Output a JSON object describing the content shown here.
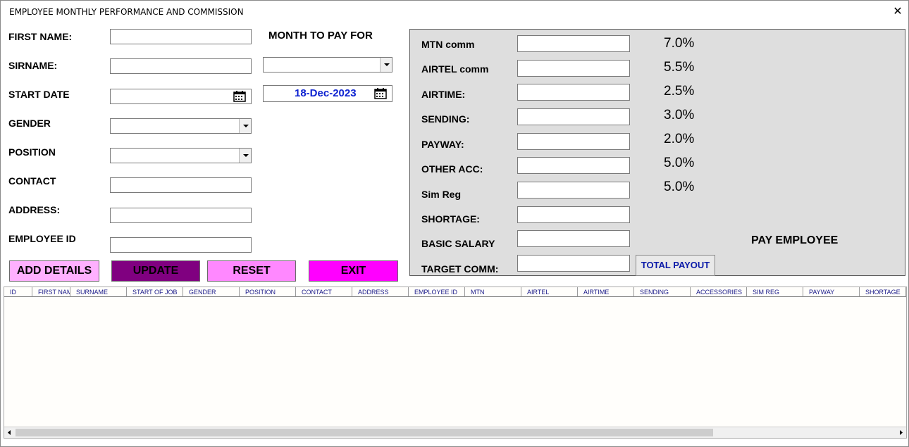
{
  "window": {
    "title": "EMPLOYEE MONTHLY PERFORMANCE AND COMMISSION",
    "close": "✕"
  },
  "form": {
    "first_name": {
      "label": "FIRST NAME:",
      "value": ""
    },
    "surname": {
      "label": "SIRNAME:",
      "value": ""
    },
    "start_date": {
      "label": "START DATE",
      "value": ""
    },
    "gender": {
      "label": "GENDER",
      "value": ""
    },
    "position": {
      "label": "POSITION",
      "value": ""
    },
    "contact": {
      "label": "CONTACT",
      "value": ""
    },
    "address": {
      "label": "ADDRESS:",
      "value": ""
    },
    "employee_id": {
      "label": "EMPLOYEE ID",
      "value": ""
    }
  },
  "month": {
    "label": "MONTH TO  PAY FOR",
    "value": "",
    "date": "18-Dec-2023"
  },
  "buttons": {
    "add": "ADD DETAILS",
    "update": "UPDATE",
    "reset": "RESET",
    "exit": "EXIT"
  },
  "commission": {
    "rows": [
      {
        "label": "MTN comm",
        "value": "",
        "rate": "7.0%"
      },
      {
        "label": "AIRTEL comm",
        "value": "",
        "rate": "5.5%"
      },
      {
        "label": "AIRTIME:",
        "value": "",
        "rate": "2.5%"
      },
      {
        "label": "SENDING:",
        "value": "",
        "rate": "3.0%"
      },
      {
        "label": "PAYWAY:",
        "value": "",
        "rate": "2.0%"
      },
      {
        "label": "OTHER ACC:",
        "value": "",
        "rate": "5.0%"
      },
      {
        "label": "Sim Reg",
        "value": "",
        "rate": "5.0%"
      },
      {
        "label": "SHORTAGE:",
        "value": ""
      },
      {
        "label": "BASIC SALARY",
        "value": ""
      },
      {
        "label": "TARGET COMM:",
        "value": ""
      }
    ],
    "pay_employee": "PAY EMPLOYEE",
    "total_payout": "TOTAL PAYOUT"
  },
  "table": {
    "columns": [
      "ID",
      "FIRST NAME",
      "SURNAME",
      "START OF JOB",
      "GENDER",
      "POSITION",
      "CONTACT",
      "ADDRESS",
      "EMPLOYEE ID",
      "MTN",
      "AIRTEL",
      "AIRTIME",
      "SENDING",
      "ACCESSORIES",
      "SIM REG",
      "PAYWAY",
      "SHORTAGE"
    ],
    "rows": []
  },
  "colors": {
    "update_bg": "#800080",
    "exit_bg": "#ff00ff",
    "add_bg": "#ffb0ff",
    "reset_bg": "#ff88ff",
    "date_text": "#0a1fd0"
  }
}
